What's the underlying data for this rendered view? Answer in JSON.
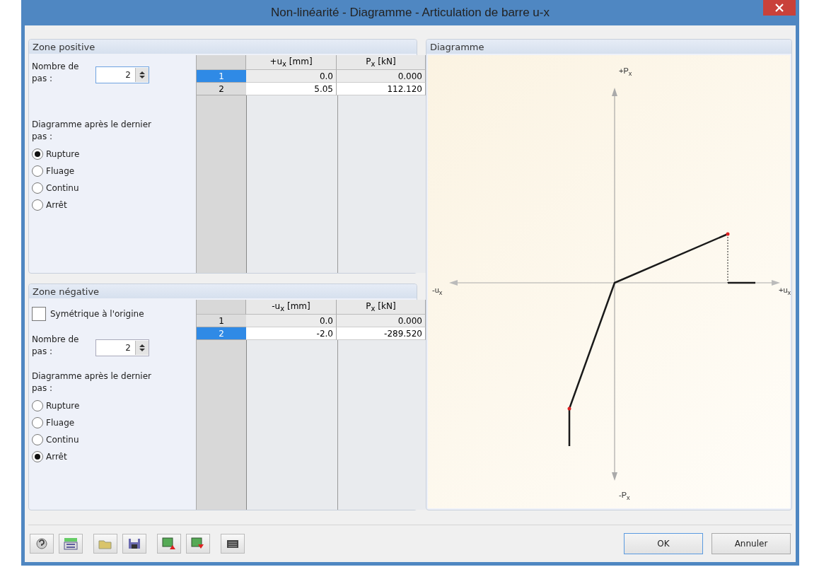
{
  "window": {
    "title": "Non-linéarité - Diagramme - Articulation de barre u-x"
  },
  "zones": [
    {
      "title": "Zone positive",
      "steps": {
        "label": "Nombre de pas :",
        "value": "2",
        "focused": true
      },
      "after_label": "Diagramme après le dernier pas :",
      "options": [
        {
          "label": "Rupture",
          "selected": true
        },
        {
          "label": "Fluage",
          "selected": false
        },
        {
          "label": "Continu",
          "selected": false
        },
        {
          "label": "Arrêt",
          "selected": false
        }
      ],
      "table": {
        "columns": [
          "+u$_{x}$ [mm]",
          "P$_{x}$ [kN]"
        ],
        "rows": [
          {
            "number": "1",
            "selected": true,
            "cells": [
              "0.0",
              "0.000"
            ]
          },
          {
            "number": "2",
            "selected": false,
            "cells": [
              "5.05",
              "112.120"
            ]
          }
        ]
      }
    },
    {
      "title": "Zone négative",
      "symmetric": {
        "label": "Symétrique à l'origine",
        "checked": false
      },
      "steps": {
        "label": "Nombre de pas :",
        "value": "2",
        "focused": false
      },
      "after_label": "Diagramme après le dernier pas :",
      "options": [
        {
          "label": "Rupture",
          "selected": false
        },
        {
          "label": "Fluage",
          "selected": false
        },
        {
          "label": "Continu",
          "selected": false
        },
        {
          "label": "Arrêt",
          "selected": true
        }
      ],
      "table": {
        "columns": [
          "-u$_{x}$ [mm]",
          "P$_{x}$ [kN]"
        ],
        "rows": [
          {
            "number": "1",
            "selected": false,
            "cells": [
              "0.0",
              "0.000"
            ]
          },
          {
            "number": "2",
            "selected": true,
            "cells": [
              "-2.0",
              "-289.520"
            ]
          }
        ]
      }
    }
  ],
  "diagram": {
    "title": "Diagramme",
    "labels": {
      "top": "+P$_{x}$",
      "bottom": "-P$_{x}$",
      "left": "-u$_{x}$",
      "right": "+u$_{x}$"
    }
  },
  "buttons": [
    "OK",
    "Annuler"
  ]
}
